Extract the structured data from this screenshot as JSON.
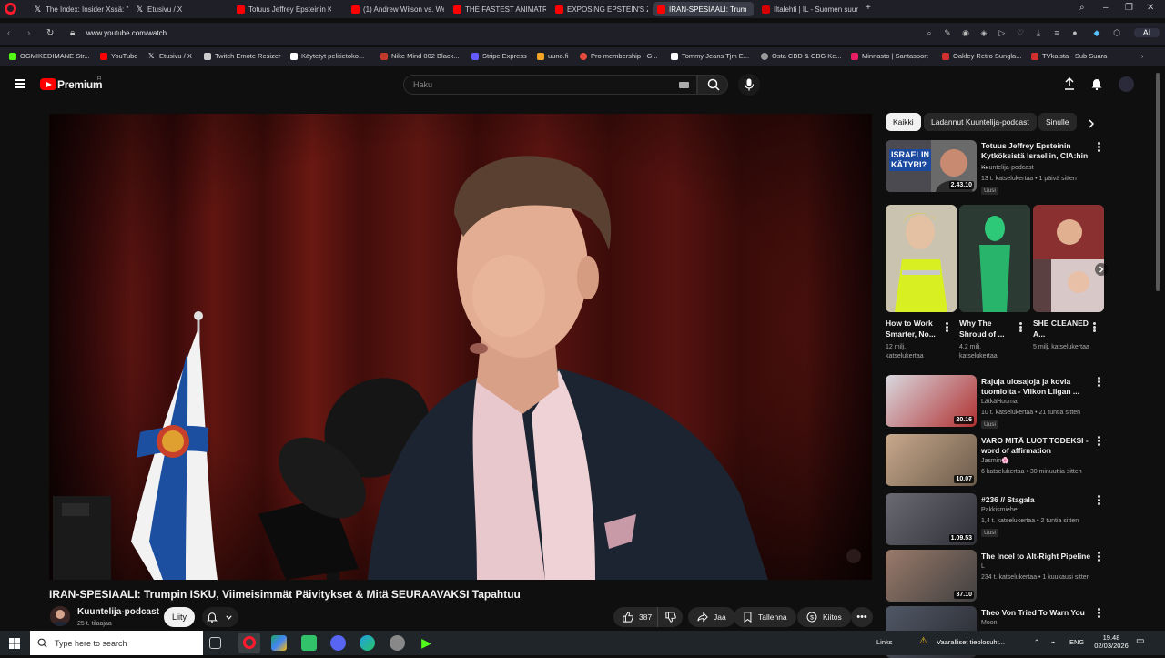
{
  "browser": {
    "tabs": [
      {
        "label": "The Index: Insider Xssä: \"E",
        "icon": "x"
      },
      {
        "label": "Etusivu / X",
        "icon": "x"
      },
      {
        "label": "Totuus Jeffrey Epsteinin K",
        "icon": "yt"
      },
      {
        "label": "(1) Andrew Wilson vs. We",
        "icon": "yt"
      },
      {
        "label": "THE FASTEST ANIMATRON",
        "icon": "yt"
      },
      {
        "label": "EXPOSING EPSTEIN'S ZOR",
        "icon": "yt"
      },
      {
        "label": "IRAN-SPESIAALI: Trum",
        "icon": "yt",
        "active": true
      },
      {
        "label": "Iltalehti | IL - Suomen suur",
        "icon": "il"
      }
    ],
    "url": "www.youtube.com/watch",
    "bookmarks": [
      {
        "label": "OGMIKEDIMANE Str...",
        "color": "#53fc18"
      },
      {
        "label": "YouTube",
        "color": "#ff0000"
      },
      {
        "label": "Etusivu / X",
        "color": "#000000"
      },
      {
        "label": "Twitch Emote Resizer",
        "color": "#cccccc"
      },
      {
        "label": "Käytetyt pelitietoko...",
        "color": "#ffffff"
      },
      {
        "label": "Nike Mind 002 Black...",
        "color": "#c0392b"
      },
      {
        "label": "Stripe Express",
        "color": "#635bff"
      },
      {
        "label": "uuno.fi",
        "color": "#f5a623"
      },
      {
        "label": "Pro membership - G...",
        "color": "#e74c3c"
      },
      {
        "label": "Tommy Jeans Tjm E...",
        "color": "#ffffff"
      },
      {
        "label": "Osta CBD & CBG Ke...",
        "color": "#999999"
      },
      {
        "label": "Minnasto | Santasport",
        "color": "#e91e63"
      },
      {
        "label": "Oakley Retro Sungla...",
        "color": "#d32f2f"
      },
      {
        "label": "TVkaista - Sub Suara",
        "color": "#d32f2f"
      }
    ],
    "ai_label": "AI"
  },
  "youtube": {
    "logo": "Premium",
    "logo_sup": "FI",
    "search_placeholder": "Haku",
    "video": {
      "title": "IRAN-SPESIAALI: Trumpin ISKU, Viimeisimmät Päivitykset & Mitä SEURAAVAKSI Tapahtuu",
      "channel": "Kuuntelija-podcast",
      "subscribers": "25 t. tilaajaa",
      "join_label": "Liity",
      "likes": "387",
      "share_label": "Jaa",
      "save_label": "Tallenna",
      "thanks_label": "Kiitos"
    },
    "chips": [
      "Kaikki",
      "Ladannut Kuuntelija-podcast",
      "Sinulle"
    ],
    "recommended_top": {
      "title": "Totuus Jeffrey Epsteinin Kytköksistä Israeliin, CIA:hin ...",
      "channel": "Kuuntelija-podcast",
      "meta": "13 t. katselukertaa • 1 päivä sitten",
      "badge": "Uusi",
      "duration": "2.43.10",
      "thumb_text": "ISRAELIN KÄTYRI?"
    },
    "shorts": [
      {
        "title": "How to Work Smarter, No...",
        "meta": "12 milj. katselukertaa"
      },
      {
        "title": "Why The Shroud of ...",
        "meta": "4,2 milj. katselukertaa"
      },
      {
        "title": "SHE CLEANED A...",
        "meta": "5 milj. katselukertaa"
      }
    ],
    "recommended": [
      {
        "title": "Rajuja ulosajoja ja kovia tuomioita - Viikon Liigan ...",
        "channel": "LätkäHuuma",
        "meta": "10 t. katselukertaa • 21 tuntia sitten",
        "badge": "Uusi",
        "duration": "20.16",
        "colors": [
          "#d9d9e0",
          "#b03030"
        ]
      },
      {
        "title": "VARO MITÄ LUOT TODEKSI - word of affirmation",
        "channel": "Jasmin🌸",
        "meta": "6 katselukertaa • 30 minuuttia sitten",
        "badge": "",
        "duration": "10.07",
        "colors": [
          "#c8a98c",
          "#6b5a4a"
        ]
      },
      {
        "title": "#236 // Stagala",
        "channel": "Pakkismiehe",
        "meta": "1,4 t. katselukertaa • 2 tuntia sitten",
        "badge": "Uusi",
        "duration": "1.09.53",
        "colors": [
          "#6a6a72",
          "#303038"
        ]
      },
      {
        "title": "The Incel to Alt-Right Pipeline",
        "channel": "L",
        "meta": "234 t. katselukertaa • 1 kuukausi sitten",
        "badge": "",
        "duration": "37.10",
        "colors": [
          "#9a7a6a",
          "#404040"
        ]
      },
      {
        "title": "Theo Von Tried To Warn You",
        "channel": "Moon",
        "meta": "",
        "badge": "",
        "duration": "",
        "colors": [
          "#505866",
          "#2a2a30"
        ]
      }
    ]
  },
  "taskbar": {
    "search_placeholder": "Type here to search",
    "links_label": "Links",
    "weather_text": "Vaaralliset tieolosuht...",
    "lang": "ENG",
    "time": "19.48",
    "date": "02/03/2026"
  }
}
